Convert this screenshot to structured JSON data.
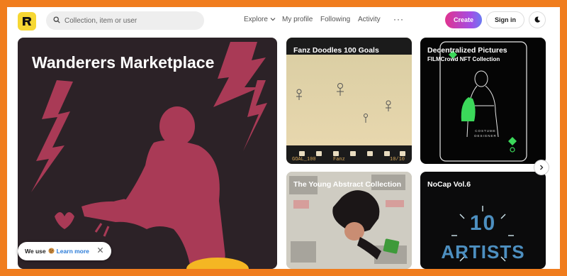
{
  "header": {
    "logo_icon": "rarible-logo-icon",
    "search": {
      "placeholder": "Collection, item or user",
      "icon": "search-icon"
    },
    "nav": {
      "explore": "Explore",
      "my_profile": "My profile",
      "following": "Following",
      "activity": "Activity",
      "more": "···"
    },
    "create_label": "Create",
    "signin_label": "Sign in",
    "theme_icon": "moon-icon"
  },
  "cards": [
    {
      "title": "Wanderers Marketplace"
    },
    {
      "title": "Fanz Doodles 100 Goals",
      "film_text_left": "GOAL_100",
      "film_text_mid": "Fanz",
      "film_text_right": "10/10"
    },
    {
      "title": "Decentralized Pictures",
      "subtitle": "FILMCrowd NFT Collection",
      "caption": "COSTUME DESIGNER"
    },
    {
      "title": "The Young Abstract Collection"
    },
    {
      "title": "NoCap Vol.6",
      "art_text_1": "10",
      "art_text_2": "ARTISTS"
    }
  ],
  "carousel": {
    "next_icon": "chevron-right-icon"
  },
  "cookie_banner": {
    "text": "We use",
    "icon": "cookie-icon",
    "link": "Learn more",
    "close_icon": "close-icon"
  },
  "colors": {
    "page_border": "#f07d1e",
    "logo_bg": "#f6d733",
    "create_gradient_start": "#e0338f",
    "create_gradient_end": "#6a7bf2",
    "hero_bg": "#2c2227",
    "hero_figure": "#a93a56",
    "link": "#2a7bd8"
  }
}
